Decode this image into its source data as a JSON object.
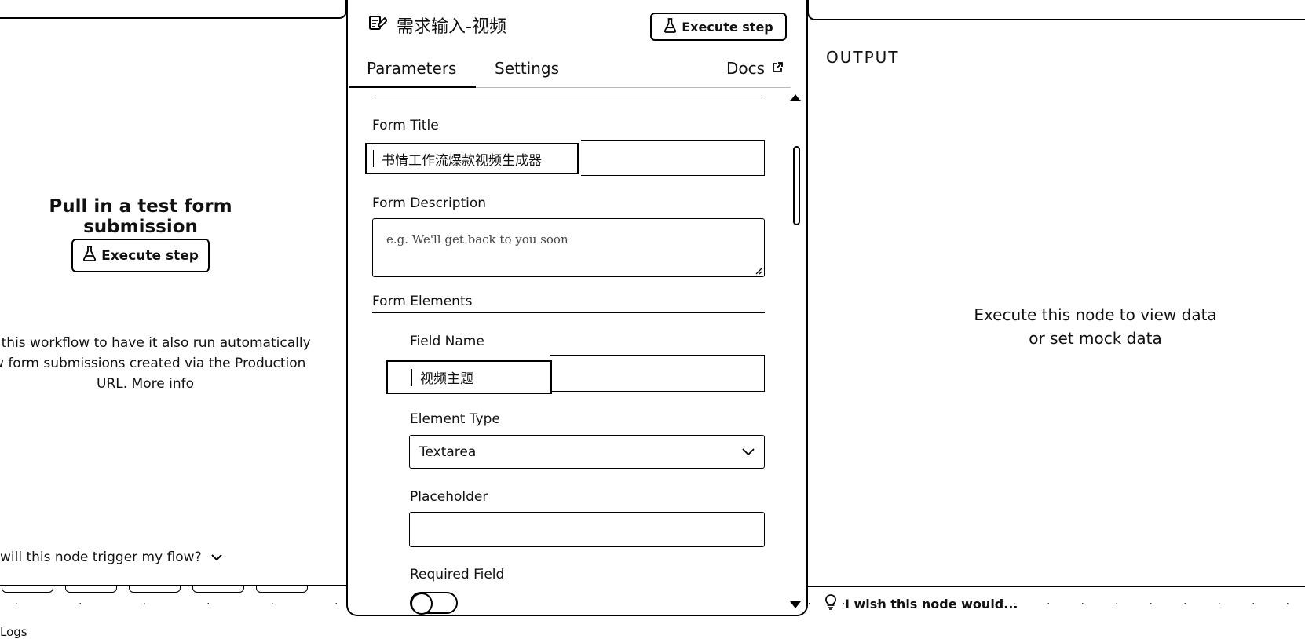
{
  "left": {
    "title": "Pull in a test form submission",
    "execute_label": "Execute step",
    "info_line1": "ite this workflow to have it also run automatically",
    "info_line2": "ew form submissions created via the Production",
    "info_line3a": "URL.",
    "info_link": "More info",
    "trigger_question": "will this node trigger my flow?",
    "logs_label": "Logs"
  },
  "node": {
    "title": "需求输入-视频",
    "execute_label": "Execute step",
    "tabs": [
      {
        "label": "Parameters",
        "active": true
      },
      {
        "label": "Settings",
        "active": false
      }
    ],
    "docs_label": "Docs"
  },
  "form": {
    "title_label": "Form Title",
    "title_value": "书情工作流爆款视频生成器",
    "description_label": "Form Description",
    "description_placeholder": "e.g. We'll get back to you soon",
    "elements_label": "Form Elements",
    "element": {
      "field_name_label": "Field Name",
      "field_name_value": "视频主题",
      "element_type_label": "Element Type",
      "element_type_value": "Textarea",
      "placeholder_label": "Placeholder",
      "placeholder_value": "",
      "required_label": "Required Field",
      "required_value": false
    }
  },
  "output": {
    "title": "OUTPUT",
    "empty_line1": "Execute this node to view data",
    "empty_line2": "or set mock data",
    "feedback_label": "I wish this node would..."
  },
  "colors": {
    "ink": "#000000",
    "background": "#ffffff"
  },
  "icons": [
    "flask-icon",
    "edit-form-icon",
    "external-link-icon",
    "chevron-down-icon",
    "lightbulb-icon"
  ]
}
